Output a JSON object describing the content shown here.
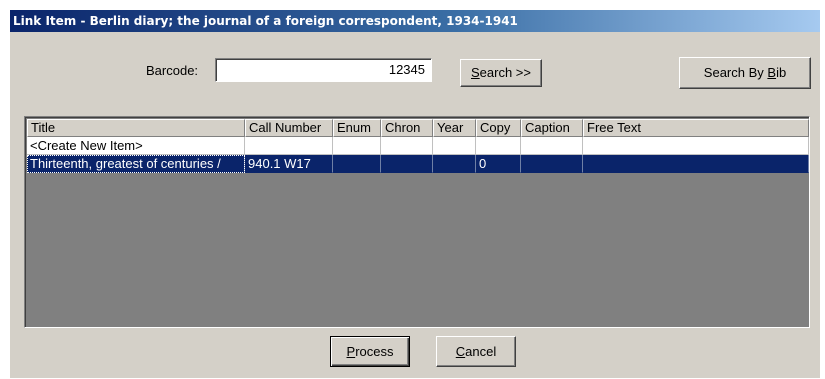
{
  "window": {
    "title": "Link Item - Berlin diary; the journal of a foreign correspondent, 1934-1941"
  },
  "search": {
    "barcode_label": "Barcode:",
    "barcode_value": "12345",
    "search_button": {
      "prefix": "",
      "mnemonic": "S",
      "rest": "earch >>"
    },
    "search_by_bib_button": {
      "prefix": "Search By ",
      "mnemonic": "B",
      "rest": "ib"
    }
  },
  "grid": {
    "columns": [
      "Title",
      "Call Number",
      "Enum",
      "Chron",
      "Year",
      "Copy",
      "Caption",
      "Free Text"
    ],
    "rows": [
      {
        "cells": [
          "<Create New Item>",
          "",
          "",
          "",
          "",
          "",
          "",
          ""
        ],
        "selected": false
      },
      {
        "cells": [
          "Thirteenth, greatest of centuries /",
          "940.1 W17",
          "",
          "",
          "",
          "0",
          "",
          ""
        ],
        "selected": true
      }
    ]
  },
  "footer": {
    "process_button": {
      "prefix": "",
      "mnemonic": "P",
      "rest": "rocess"
    },
    "cancel_button": {
      "prefix": "",
      "mnemonic": "C",
      "rest": "ancel"
    }
  },
  "colors": {
    "titlebar_start": "#0a246a",
    "titlebar_end": "#a6caf0",
    "dialog_face": "#d4d0c8",
    "grid_empty": "#808080",
    "selection": "#0a246a"
  }
}
